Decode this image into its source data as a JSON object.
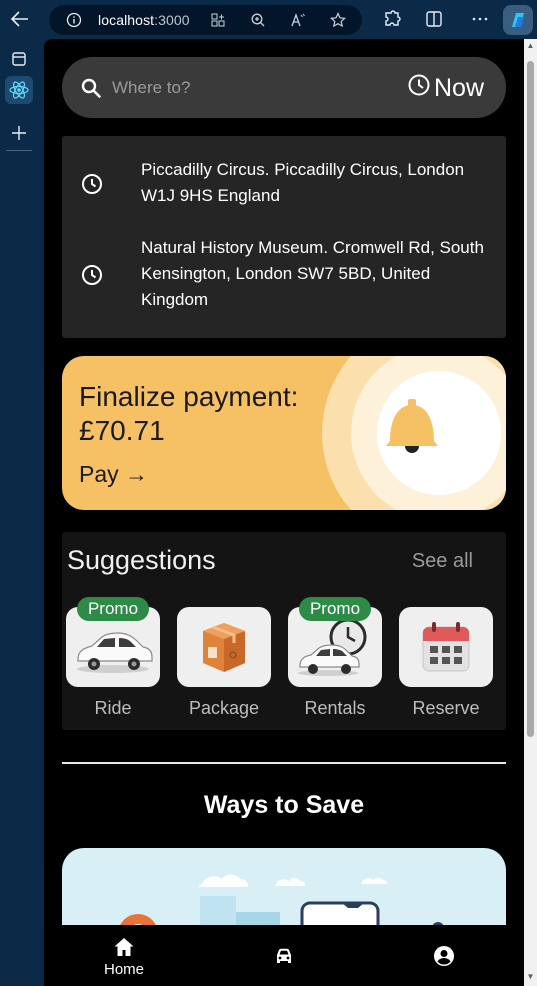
{
  "browser": {
    "url_host": "localhost",
    "url_port": ":3000"
  },
  "search": {
    "placeholder": "Where to?",
    "now_label": "Now"
  },
  "recent_places": [
    {
      "text": "Piccadilly Circus. Piccadilly Circus, London W1J 9HS England"
    },
    {
      "text": "Natural History Museum. Cromwell Rd, South Kensington, London SW7 5BD, United Kingdom"
    }
  ],
  "payment": {
    "title": "Finalize payment: £70.71",
    "action": "Pay →",
    "accent_color": "#f6c064"
  },
  "suggestions": {
    "title": "Suggestions",
    "see_all": "See all",
    "items": [
      {
        "label": "Ride",
        "badge": "Promo",
        "icon": "car-icon"
      },
      {
        "label": "Package",
        "badge": "",
        "icon": "package-icon"
      },
      {
        "label": "Rentals",
        "badge": "Promo",
        "icon": "car-clock-icon"
      },
      {
        "label": "Reserve",
        "badge": "",
        "icon": "calendar-icon"
      }
    ]
  },
  "ways_to_save": {
    "title": "Ways to Save"
  },
  "bottom_nav": {
    "items": [
      {
        "label": "Home",
        "icon": "home-icon"
      },
      {
        "label": "",
        "icon": "car-icon"
      },
      {
        "label": "",
        "icon": "account-icon"
      }
    ]
  }
}
